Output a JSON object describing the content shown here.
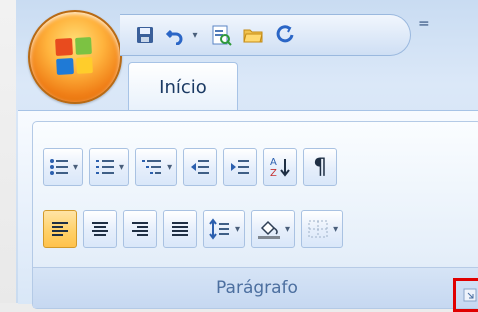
{
  "tabs": {
    "active_label": "Início"
  },
  "group": {
    "label": "Parágrafo"
  },
  "qat": {
    "customize_glyph": "="
  },
  "ribbon": {
    "pilcrow": "¶"
  },
  "colors": {
    "launcher_highlight": "#e00000",
    "accent": "#ffc24b"
  }
}
